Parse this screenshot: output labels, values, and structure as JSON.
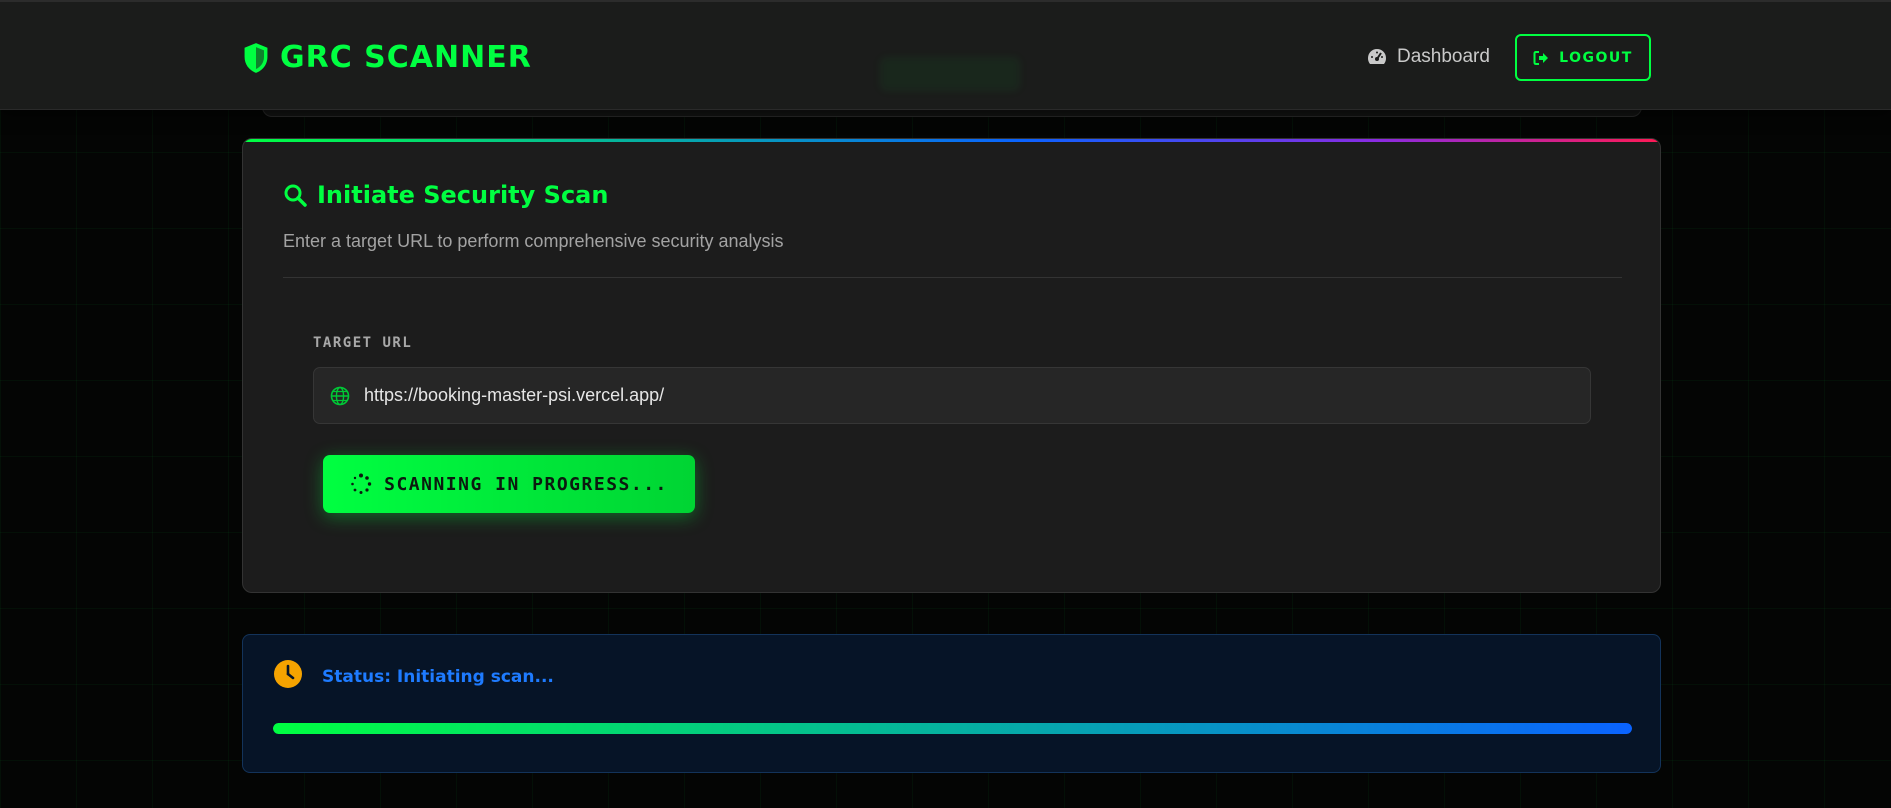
{
  "navbar": {
    "brand": "GRC SCANNER",
    "dashboard_label": "Dashboard",
    "logout_label": "LOGOUT"
  },
  "scan_card": {
    "title": "Initiate Security Scan",
    "subtitle": "Enter a target URL to perform comprehensive security analysis",
    "field_label": "TARGET URL",
    "url_value": "https://booking-master-psi.vercel.app/",
    "button_label": "SCANNING IN PROGRESS..."
  },
  "status": {
    "text": "Status: Initiating scan...",
    "progress": 1.0
  },
  "colors": {
    "accent": "#00ff41",
    "status_blue": "#1e7bff",
    "clock_amber": "#f5a300"
  },
  "icons": {
    "brand": "shield-icon",
    "dashboard": "gauge-icon",
    "logout": "sign-out-icon",
    "title": "search-icon",
    "input": "globe-icon",
    "button": "spinner-icon",
    "status": "clock-icon"
  }
}
